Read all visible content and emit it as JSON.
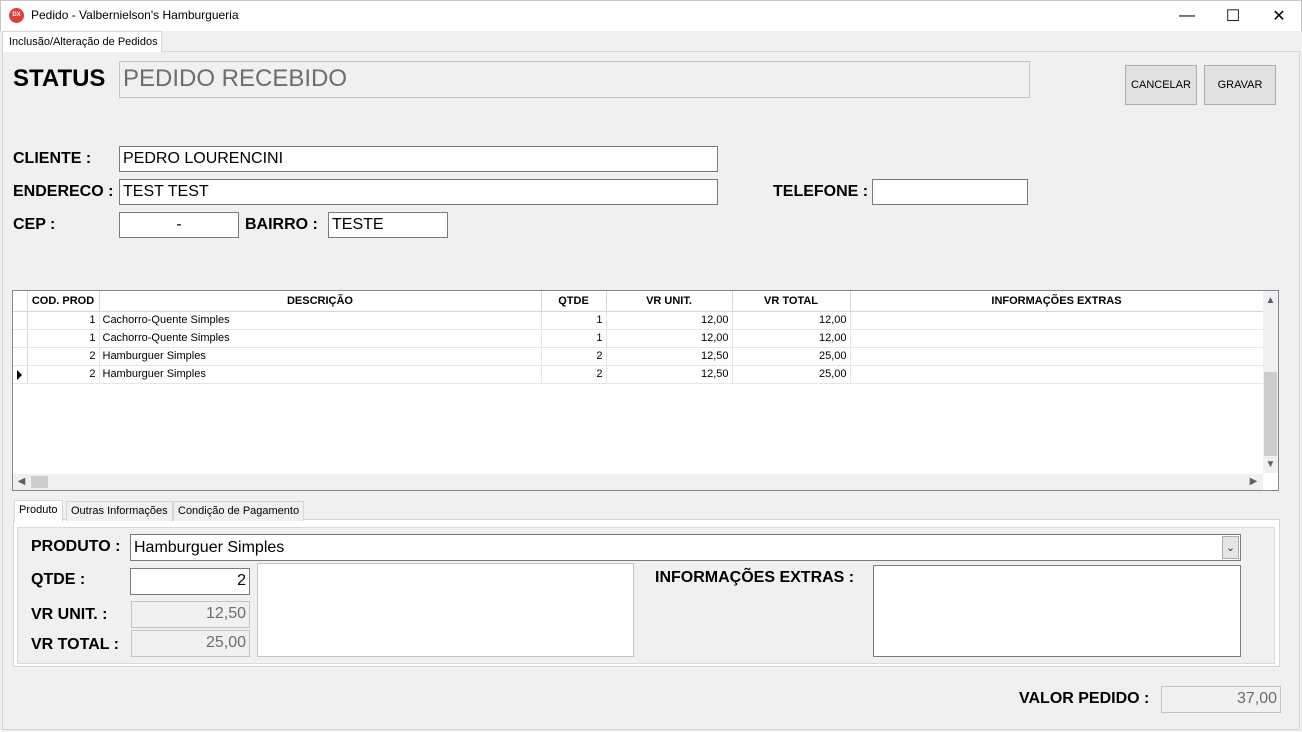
{
  "window": {
    "icon_text": "DX",
    "title": "Pedido - Valbernielson's Hamburgueria",
    "minimize": "—",
    "maximize": "☐",
    "close": "✕"
  },
  "outer_tab": {
    "label": "Inclusão/Alteração de Pedidos"
  },
  "status": {
    "label": "STATUS",
    "value": "PEDIDO RECEBIDO"
  },
  "buttons": {
    "cancel": "CANCELAR",
    "save": "GRAVAR"
  },
  "form": {
    "cliente_label": "CLIENTE :",
    "cliente_value": "PEDRO LOURENCINI",
    "endereco_label": "ENDERECO :",
    "endereco_value": "TEST TEST",
    "telefone_label": "TELEFONE :",
    "telefone_value": "",
    "cep_label": "CEP :",
    "cep_value": "-",
    "bairro_label": "BAIRRO :",
    "bairro_value": "TESTE"
  },
  "grid": {
    "columns": [
      "COD. PROD",
      "DESCRIÇÃO",
      "QTDE",
      "VR UNIT.",
      "VR TOTAL",
      "INFORMAÇÕES EXTRAS"
    ],
    "rows": [
      [
        "1",
        "Cachorro-Quente Simples",
        "1",
        "12,00",
        "12,00",
        ""
      ],
      [
        "1",
        "Cachorro-Quente Simples",
        "1",
        "12,00",
        "12,00",
        ""
      ],
      [
        "2",
        "Hamburguer Simples",
        "2",
        "12,50",
        "25,00",
        ""
      ],
      [
        "2",
        "Hamburguer Simples",
        "2",
        "12,50",
        "25,00",
        ""
      ]
    ],
    "current_row": 3
  },
  "inner_tabs": [
    "Produto",
    "Outras Informações",
    "Condição de Pagamento"
  ],
  "produto": {
    "produto_label": "PRODUTO :",
    "produto_value": "Hamburguer Simples",
    "qtde_label": "QTDE :",
    "qtde_value": "2",
    "vr_unit_label": "VR UNIT. :",
    "vr_unit_value": "12,50",
    "vr_total_label": "VR TOTAL :",
    "vr_total_value": "25,00",
    "info_extras_label": "INFORMAÇÕES EXTRAS :",
    "info_extras_value": ""
  },
  "footer": {
    "valor_label": "VALOR PEDIDO :",
    "valor_value": "37,00"
  }
}
